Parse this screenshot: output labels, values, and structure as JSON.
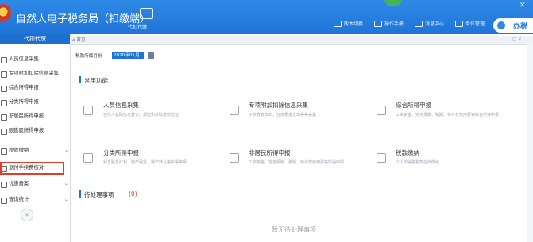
{
  "header": {
    "title": "自然人电子税务局（扣缴端）",
    "kiosk_label": "代扣代缴",
    "links": [
      {
        "label": "版本切换",
        "icon": "switch-icon"
      },
      {
        "label": "操作手册",
        "icon": "manual-icon"
      },
      {
        "label": "消息中心",
        "icon": "mail-icon"
      },
      {
        "label": "单位管理",
        "icon": "unit-icon"
      }
    ],
    "help_label": "办税",
    "window_controls": {
      "minimize": "−",
      "close": "✕"
    }
  },
  "sidebar": {
    "title": "代扣代缴",
    "items": [
      {
        "label": "人员信息采集",
        "icon": "person-icon",
        "expandable": false
      },
      {
        "label": "专项附加扣除信息采集",
        "icon": "list-icon",
        "expandable": false
      },
      {
        "label": "综合所得申报",
        "icon": "report-icon",
        "expandable": false
      },
      {
        "label": "分类所得申报",
        "icon": "category-icon",
        "expandable": false
      },
      {
        "label": "非居民所得申报",
        "icon": "nonresident-icon",
        "expandable": false
      },
      {
        "label": "限售股所得申报",
        "icon": "stock-icon",
        "expandable": false
      },
      {
        "label": "税款缴纳",
        "icon": "payment-icon",
        "expandable": true
      },
      {
        "label": "退付手续费核对",
        "icon": "refund-icon",
        "expandable": false
      },
      {
        "label": "优惠备案",
        "icon": "discount-icon",
        "expandable": true
      },
      {
        "label": "查询统计",
        "icon": "search-icon",
        "expandable": true
      }
    ],
    "collapse_glyph": "«"
  },
  "tabs": {
    "home": "首页",
    "close_glyph": "◻ ×"
  },
  "period": {
    "label": "税款所属月份",
    "value": "2020年01月"
  },
  "common_functions": {
    "title": "常用功能",
    "cards": [
      {
        "title": "人员信息采集",
        "desc": "自然人基础信息登记、报送和获取身份验证",
        "icon": "person-card-icon"
      },
      {
        "title": "专项附加扣除信息采集",
        "desc": "子女教育支出、住房租金支出等等采集",
        "icon": "deduction-card-icon"
      },
      {
        "title": "综合所得申报",
        "desc": "工资薪金、劳务报酬、稿酬、特许权使用费等综合所得申报",
        "icon": "comprehensive-card-icon"
      },
      {
        "title": "分类所得申报",
        "desc": "利息股息红利、财产租赁、财产转让等所得申报",
        "icon": "classified-card-icon"
      },
      {
        "title": "非居民所得申报",
        "desc": "工资薪金、劳务报酬、稿酬、特许权使用费等所得申报",
        "icon": "nonresident-card-icon"
      },
      {
        "title": "税款缴纳",
        "desc": "个人所得税税款在线缴纳",
        "icon": "tax-payment-card-icon"
      }
    ]
  },
  "pending": {
    "title": "待处理事项",
    "count": "(0)",
    "empty_text": "暂无待处理事项"
  },
  "colors": {
    "primary": "#1f74d8",
    "header": "#2f8ae6",
    "highlight": "#e23b2e"
  }
}
